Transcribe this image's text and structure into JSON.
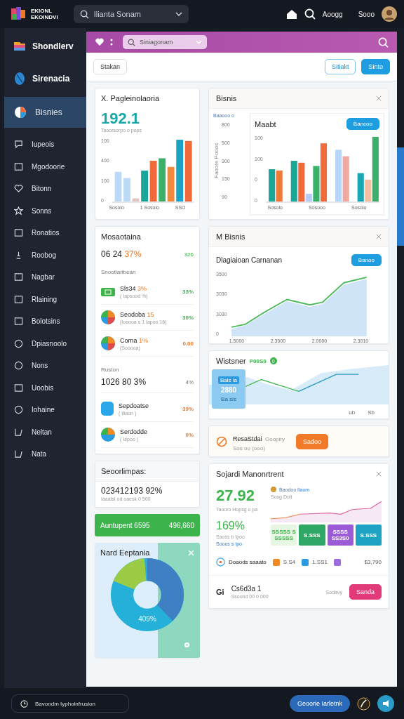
{
  "topbar": {
    "logo": [
      "EKIONL",
      "EKOINDVI"
    ],
    "search": {
      "value": "Ilianta Sonam"
    },
    "user_label": "Aoogg",
    "account": "Sooo"
  },
  "sidebar": {
    "brand": "Shondlerv",
    "workspace": "Sirenacia",
    "items": [
      {
        "label": "Bisnies",
        "selected": true
      },
      {
        "label": "Iupeois",
        "selected": false
      },
      {
        "label": "Mgodoorie",
        "selected": false
      },
      {
        "label": "Bitonn",
        "selected": false
      },
      {
        "label": "Sonns",
        "selected": false
      },
      {
        "label": "Ronatios",
        "selected": false
      },
      {
        "label": "Roobog",
        "selected": false
      },
      {
        "label": "Nagbar",
        "selected": false
      },
      {
        "label": "Rlaining",
        "selected": false
      },
      {
        "label": "Bolotsins",
        "selected": false
      },
      {
        "label": "Dpiasnoolo",
        "selected": false
      },
      {
        "label": "Nons",
        "selected": false
      },
      {
        "label": "Uoobis",
        "selected": false
      },
      {
        "label": "Iohaine",
        "selected": false
      },
      {
        "label": "Neltan",
        "selected": false
      },
      {
        "label": "Nata",
        "selected": false
      }
    ]
  },
  "panel": {
    "search": {
      "value": "Siniagonam"
    },
    "toolbar": {
      "left_button": "Stakan",
      "buttons": [
        {
          "label": "Sitiakt",
          "kind": "outline"
        },
        {
          "label": "Sinto",
          "kind": "primary"
        }
      ]
    }
  },
  "overview_card": {
    "title": "X. Pagleinolaoria",
    "value": "192.1",
    "caption": "Taoorsorpo o pops",
    "y_ticks": [
      "100",
      "400",
      "100",
      "0"
    ],
    "x_labels": [
      "Sosolo",
      "1 Sosolo",
      "SSO"
    ]
  },
  "bisnis_card": {
    "title": "Bisnis",
    "legend": "Baaooo o",
    "ylabel": "Faoore Pooos",
    "y_ticks": [
      "800",
      "500",
      "300",
      "150",
      "90"
    ],
    "inner": {
      "title": "Maabt",
      "button": "Bancoo",
      "y_ticks": [
        "100",
        "100",
        "0",
        "0"
      ],
      "x_labels": [
        "Sosolo",
        "Sosooo",
        "Sosolo"
      ]
    }
  },
  "list_card": {
    "title": "Mosaotaina",
    "value": "06 24",
    "value_change": "37%",
    "value_side": "326",
    "section": "Snootlaribean",
    "rows": [
      {
        "kind": "tag",
        "name": "Sls34",
        "change": "3%",
        "note": "( Iapsood %)",
        "value": "33%",
        "color": "#3cb44b"
      },
      {
        "kind": "pie",
        "name": "Seodoba",
        "change": "15",
        "note": "(Iooooa s 1 Iapoo 16)",
        "value": "30%",
        "color": "#3cb44b"
      },
      {
        "kind": "pie",
        "name": "Corna",
        "change": "1%",
        "note": "(Sooooa)",
        "value": "0.00",
        "color": "#f07a28"
      }
    ],
    "section2": "Ruston",
    "total": "1026 80 3%",
    "total_side": "4%",
    "rows2": [
      {
        "kind": "cylinder",
        "name": "Sepdoatse",
        "note": "( Iliaon )",
        "value": "39%",
        "color": "#f07a28"
      },
      {
        "kind": "pie",
        "name": "Serdodde",
        "note": "( Iepoo )",
        "value": "0%",
        "color": "#f07a28"
      }
    ]
  },
  "line_card": {
    "title": "M Bisnis",
    "subtitle": "Dlagiaioan Carnanan",
    "button": "Banoo",
    "y_ticks": [
      "3500",
      "3030",
      "3030",
      "0"
    ],
    "x_labels": [
      "1.5000",
      "2.3000",
      "2.0000",
      "2.3010"
    ]
  },
  "trend_card": {
    "title": "Wistsner",
    "badge": "P00S0",
    "dot": "0",
    "tooltip": {
      "label": "Bals ia",
      "value": "2880",
      "sub": "Ba sis"
    },
    "x_labels": [
      "ub",
      "Sb"
    ]
  },
  "alert": {
    "title": "ResaStdai",
    "meta": "Ooopiry",
    "sub": "Sos oo (ooo)",
    "button": "Sadoo"
  },
  "summary_card": {
    "title": "Seoorlimpas:",
    "value": "023412193 92%",
    "caption": "Iaaatsl od oaesk 0 500"
  },
  "green_bar": {
    "label": "Auntupent 6595",
    "value": "496,660"
  },
  "donut_card": {
    "title": "Nard Eeptania",
    "value": "409%"
  },
  "monitor_card": {
    "title": "Sojardi Manonrtrent",
    "value": "27.92",
    "caption": "Taooro Hopsg o pa",
    "percent": "169%",
    "caption2": "Saoss b Ipoo",
    "link": "Sooos s Ipo",
    "legend": "Baodoo Ilaom",
    "series_label": "Sosg Dolt",
    "tiles": [
      {
        "text": "SSSSS S",
        "sub": "SSSSS",
        "color": "#e8f6e4"
      },
      {
        "text": "S.SSS",
        "color": "#2fa866"
      },
      {
        "text": "SSSS",
        "sub": "SS3S0",
        "color": "#9b5bd6"
      },
      {
        "text": "S.SSS",
        "color": "#1fa3c4"
      }
    ],
    "stats_label": "Doaods saaato",
    "stats": [
      {
        "value": "S.S4",
        "color": "#f08a24"
      },
      {
        "value": "1.SS1",
        "color": "#2a9be0"
      },
      {
        "color": "#9b6be0"
      }
    ],
    "total": "$3,790",
    "footer": {
      "mark": "Gi",
      "name": "Cs6d3a 1",
      "sub": "Ssoond 00 0 000",
      "meta": "Sodavy",
      "button": "Sanda"
    }
  },
  "bottombar": {
    "status": "Bavondm Iyphoinfrusion",
    "button": "Geoorie Iarletnk"
  }
}
